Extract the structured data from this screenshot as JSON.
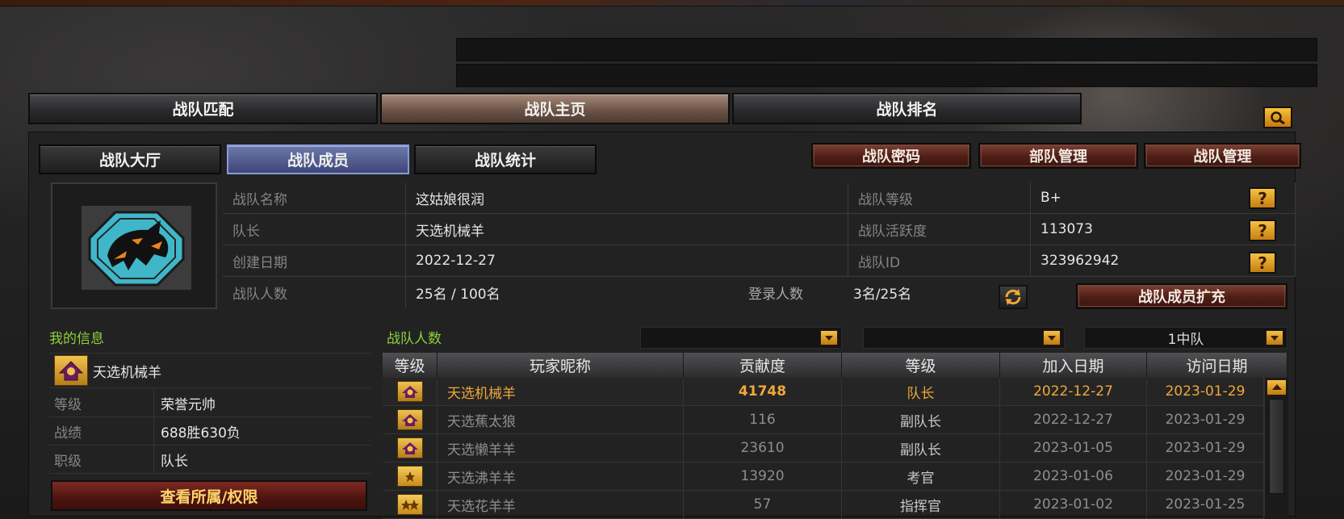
{
  "top_tabs": [
    "战队匹配",
    "战队主页",
    "战队排名"
  ],
  "sub_tabs": [
    "战队大厅",
    "战队成员",
    "战队统计"
  ],
  "action_buttons": [
    "战队密码",
    "部队管理",
    "战队管理"
  ],
  "team_info": {
    "name_label": "战队名称",
    "name": "这姑娘很润",
    "leader_label": "队长",
    "leader": "天选机械羊",
    "created_label": "创建日期",
    "created": "2022-12-27",
    "members_label": "战队人数",
    "members": "25名 / 100名",
    "login_label": "登录人数",
    "login": "3名/25名",
    "grade_label": "战队等级",
    "grade": "B+",
    "activity_label": "战队活跃度",
    "activity": "113073",
    "id_label": "战队ID",
    "id": "323962942",
    "help_glyph": "?",
    "expand_button": "战队成员扩充"
  },
  "my_info": {
    "title": "我的信息",
    "name": "天选机械羊",
    "rows": [
      {
        "label": "等级",
        "value": "荣誉元帅"
      },
      {
        "label": "战绩",
        "value": "688胜630负"
      },
      {
        "label": "职级",
        "value": "队长"
      }
    ],
    "button": "查看所属/权限"
  },
  "members_list": {
    "title": "战队人数",
    "filters": [
      "",
      "",
      "1中队"
    ],
    "columns": [
      "等级",
      "玩家昵称",
      "贡献度",
      "等级",
      "加入日期",
      "访问日期"
    ],
    "rows": [
      {
        "rank_icon": "marshal-badge-icon",
        "nick": "天选机械羊",
        "contribution": "41748",
        "role": "队长",
        "joined": "2022-12-27",
        "visited": "2023-01-29"
      },
      {
        "rank_icon": "marshal-badge-icon",
        "nick": "天选蕉太狼",
        "contribution": "116",
        "role": "副队长",
        "joined": "2022-12-27",
        "visited": "2023-01-29"
      },
      {
        "rank_icon": "marshal-badge-icon",
        "nick": "天选懒羊羊",
        "contribution": "23610",
        "role": "副队长",
        "joined": "2023-01-05",
        "visited": "2023-01-29"
      },
      {
        "rank_icon": "general-one-star-icon",
        "nick": "天选沸羊羊",
        "contribution": "13920",
        "role": "考官",
        "joined": "2023-01-06",
        "visited": "2023-01-29"
      },
      {
        "rank_icon": "general-two-star-icon",
        "nick": "天选花羊羊",
        "contribution": "57",
        "role": "指挥官",
        "joined": "2023-01-02",
        "visited": "2023-01-25"
      }
    ]
  },
  "colors": {
    "accent_gold": "#f0a83a",
    "label_green": "#8bd33a",
    "active_tab_blue": "#5a66a0"
  }
}
